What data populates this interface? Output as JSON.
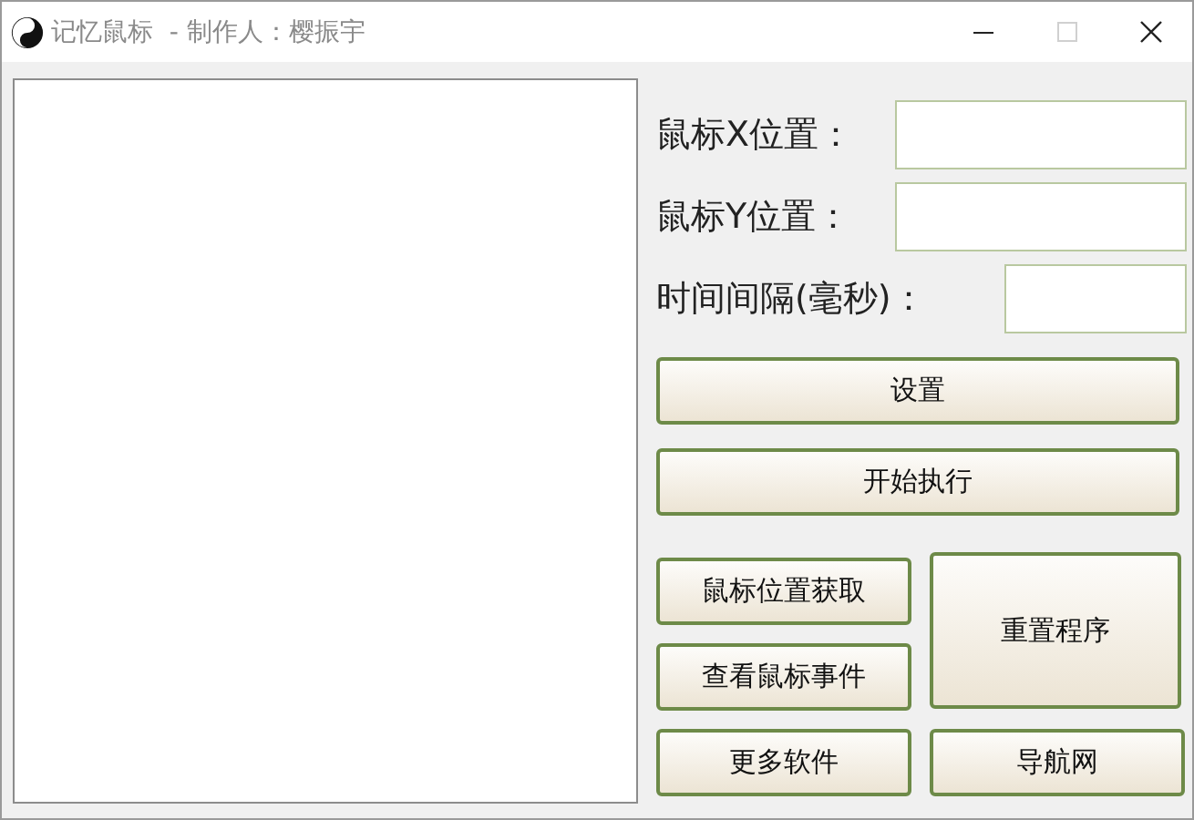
{
  "window": {
    "title": "记忆鼠标  - 制作人：樱振宇",
    "controls": [
      {
        "kind": "minimize",
        "disabled": false
      },
      {
        "kind": "maximize",
        "disabled": true
      },
      {
        "kind": "close",
        "disabled": false
      }
    ]
  },
  "fields": [
    {
      "label": "鼠标X位置："
    },
    {
      "label": "鼠标Y位置："
    },
    {
      "label": "时间间隔(毫秒)："
    }
  ],
  "wide_buttons": [
    "设置",
    "开始执行"
  ],
  "grid_buttons": [
    {
      "label": "鼠标位置获取",
      "kind": "small"
    },
    {
      "label": "重置程序",
      "kind": "tall"
    },
    {
      "label": "查看鼠标事件",
      "kind": "small"
    },
    {
      "label": "更多软件",
      "kind": "small"
    },
    {
      "label": "导航网",
      "kind": "small"
    }
  ]
}
